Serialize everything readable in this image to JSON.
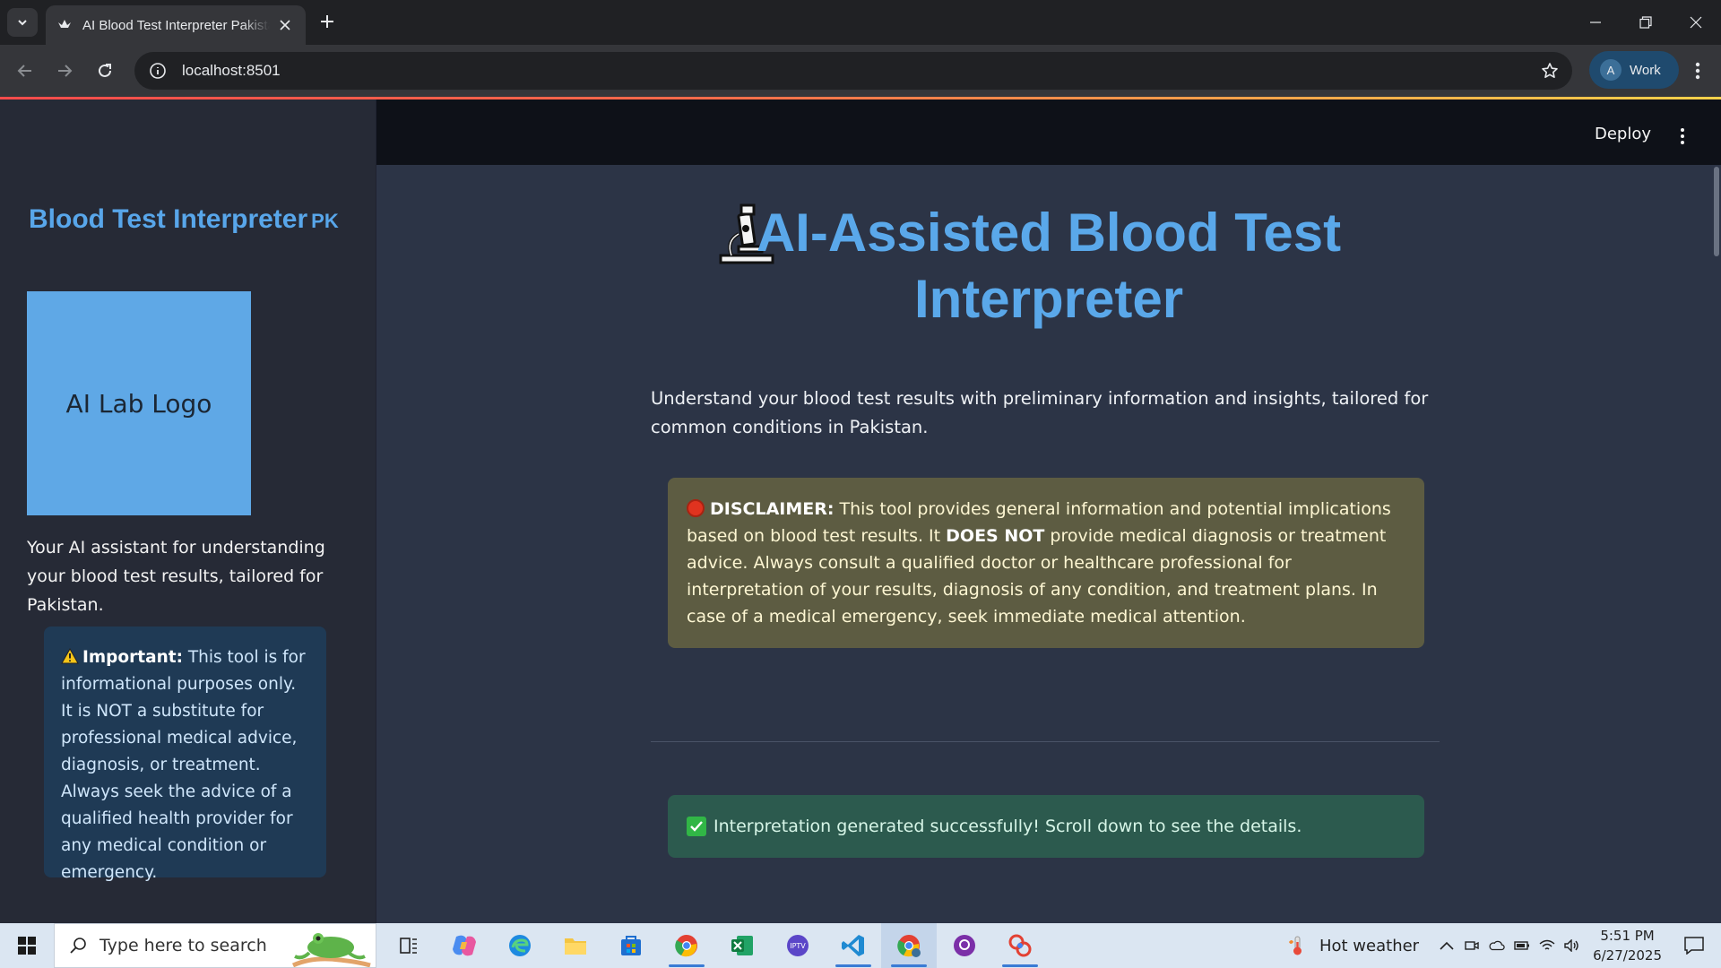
{
  "browser": {
    "tab_title": "AI Blood Test Interpreter Pakistan",
    "url": "localhost:8501",
    "profile_initial": "A",
    "profile_name": "Work"
  },
  "app": {
    "header": {
      "deploy_label": "Deploy"
    },
    "sidebar": {
      "title": "Blood Test Interpreter",
      "title_badge": "PK",
      "logo_text": "AI Lab Logo",
      "caption": "Your AI assistant for understanding your blood test results, tailored for Pakistan.",
      "alert": {
        "icon": "warning-icon",
        "strong": "Important:",
        "text": " This tool is for informational purposes only. It is NOT a substitute for professional medical advice, diagnosis, or treatment. Always seek the advice of a qualified health provider for any medical condition or emergency."
      }
    },
    "main": {
      "title": "AI-Assisted Blood Test Interpreter",
      "title_icon": "microscope-icon",
      "intro": "Understand your blood test results with preliminary information and insights, tailored for common conditions in Pakistan.",
      "disclaimer": {
        "icon": "stop-icon",
        "strong": "DISCLAIMER:",
        "part1": " This tool provides general information and potential implications based on blood test results. It ",
        "strong2": "DOES NOT",
        "part2": " provide medical diagnosis or treatment advice. Always consult a qualified doctor or healthcare professional for interpretation of your results, diagnosis of any condition, and treatment plans. In case of a medical emergency, seek immediate medical attention."
      },
      "success": {
        "icon": "check-icon",
        "text": "Interpretation generated successfully! Scroll down to see the details."
      }
    }
  },
  "taskbar": {
    "search_placeholder": "Type here to search",
    "weather": "Hot weather",
    "time": "5:51 PM",
    "date": "6/27/2025"
  },
  "colors": {
    "accent_blue": "#58a6ea",
    "warning_bg": "#5d5c42",
    "success_bg": "#2c5a4e",
    "info_bg": "#1f3a55"
  }
}
